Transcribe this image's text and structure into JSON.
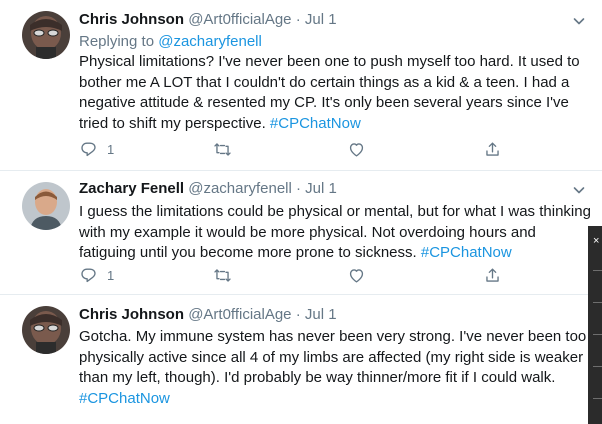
{
  "colors": {
    "link": "#1b95e0",
    "muted": "#657786",
    "text": "#14171a",
    "divider": "#e6ecf0"
  },
  "tweets": [
    {
      "name": "Chris Johnson",
      "handle": "@Art0fficialAge",
      "separator": "·",
      "date": "Jul 1",
      "replying_prefix": "Replying to",
      "replying_to": "@zacharyfenell",
      "text": "Physical limitations? I've never been one to push myself too hard. It used to bother me A LOT that I couldn't do certain things as a kid & a teen. I had a negative attitude & resented my CP. It's only been several years since I've tried to shift my perspective.",
      "hashtag": "#CPChatNow",
      "reply_count": "1",
      "avatar_icon": "avatar-photo"
    },
    {
      "name": "Zachary Fenell",
      "handle": "@zacharyfenell",
      "separator": "·",
      "date": "Jul 1",
      "text": "I guess the limitations could be physical or mental, but for what I was thinking with my example it would be more physical. Not overdoing hours and fatiguing until you become more prone to sickness.",
      "hashtag": "#CPChatNow",
      "reply_count": "1",
      "avatar_icon": "avatar-photo"
    },
    {
      "name": "Chris Johnson",
      "handle": "@Art0fficialAge",
      "separator": "·",
      "date": "Jul 1",
      "text": "Gotcha. My immune system has never been very strong. I've never been too physically active since all 4 of my limbs are affected (my right side is weaker than my left, though). I'd probably be way thinner/more fit if I could walk.",
      "hashtag": "#CPChatNow",
      "avatar_icon": "avatar-photo"
    }
  ],
  "action_icons": [
    "reply-icon",
    "retweet-icon",
    "like-icon",
    "share-icon"
  ],
  "overlay": {
    "close_glyph": "×"
  }
}
